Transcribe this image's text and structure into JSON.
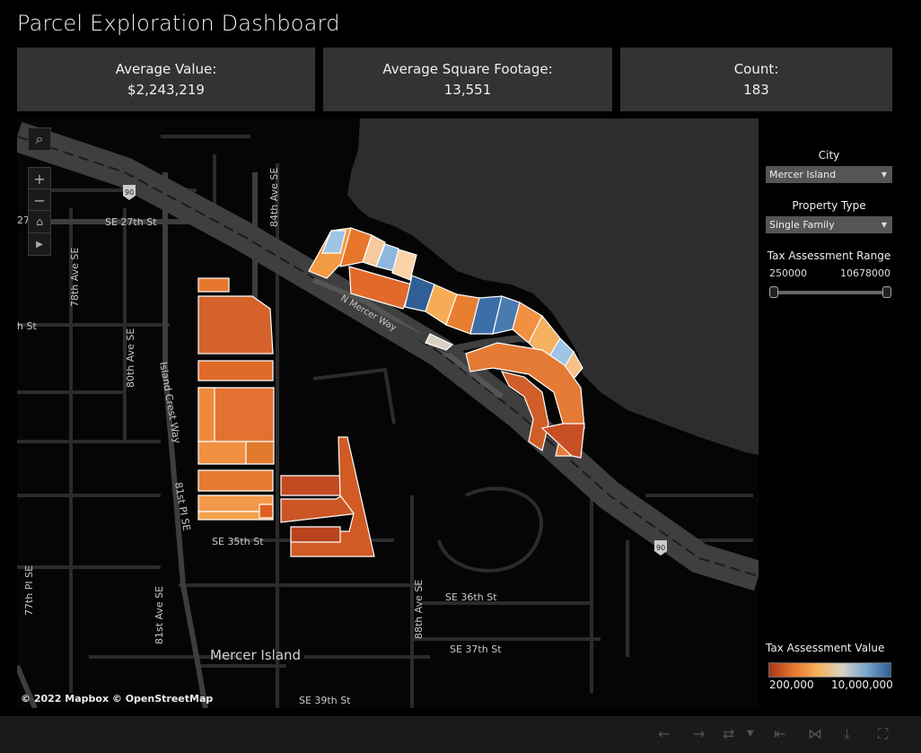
{
  "title": "Parcel Exploration Dashboard",
  "kpis": {
    "avg_value_label": "Average Value:",
    "avg_value": "$2,243,219",
    "avg_sqft_label": "Average Square Footage:",
    "avg_sqft": "13,551",
    "count_label": "Count:",
    "count": "183"
  },
  "filters": {
    "city_label": "City",
    "city_value": "Mercer Island",
    "type_label": "Property Type",
    "type_value": "Single Family",
    "range_label": "Tax Assessment Range",
    "range_min": "250000",
    "range_max": "10678000"
  },
  "legend": {
    "title": "Tax Assessment Value",
    "min": "200,000",
    "max": "10,000,000",
    "colors": [
      "#a8381a",
      "#e6762c",
      "#f6b15a",
      "#d9d2c4",
      "#7aa6cf",
      "#2f5f95"
    ]
  },
  "map": {
    "attribution": "© 2022 Mapbox  © OpenStreetMap",
    "labels": {
      "se27": "SE 27th St",
      "ave84": "84th Ave SE",
      "ave78": "78th Ave SE",
      "ave80": "80th Ave SE",
      "icw": "Island Crest Way",
      "pl81": "81st PI SE",
      "se35": "SE 35th St",
      "pl77": "77th PI SE",
      "ave81": "81st Ave SE",
      "mercer": "Mercer Island",
      "se39": "SE 39th St",
      "ave88": "88th Ave SE",
      "se36": "SE 36th St",
      "se37": "SE 37th St",
      "nmw": "N Mercer Way",
      "hst": "h St",
      "n27": "27",
      "i90": "90"
    }
  }
}
